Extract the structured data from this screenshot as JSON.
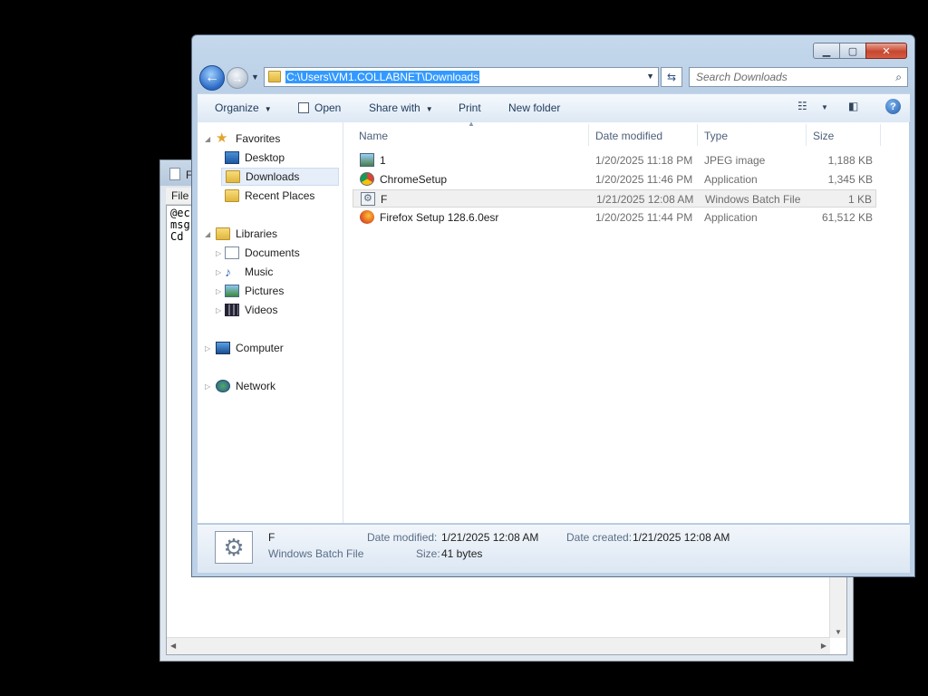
{
  "notepad": {
    "title_partial": "F",
    "menu_file": "File",
    "text": "@ec\nmsg\nCd"
  },
  "explorer": {
    "address": "C:\\Users\\VM1.COLLABNET\\Downloads",
    "search_placeholder": "Search Downloads",
    "toolbar": {
      "organize": "Organize",
      "open": "Open",
      "share_with": "Share with",
      "print": "Print",
      "new_folder": "New folder"
    },
    "nav": {
      "favorites": "Favorites",
      "desktop": "Desktop",
      "downloads": "Downloads",
      "recent_places": "Recent Places",
      "libraries": "Libraries",
      "documents": "Documents",
      "music": "Music",
      "pictures": "Pictures",
      "videos": "Videos",
      "computer": "Computer",
      "network": "Network"
    },
    "columns": {
      "name": "Name",
      "date_modified": "Date modified",
      "type": "Type",
      "size": "Size"
    },
    "files": [
      {
        "name": "1",
        "date": "1/20/2025 11:18 PM",
        "type": "JPEG image",
        "size": "1,188 KB",
        "icon": "jpeg-icon"
      },
      {
        "name": "ChromeSetup",
        "date": "1/20/2025 11:46 PM",
        "type": "Application",
        "size": "1,345 KB",
        "icon": "chrome-icon"
      },
      {
        "name": "F",
        "date": "1/21/2025 12:08 AM",
        "type": "Windows Batch File",
        "size": "1 KB",
        "icon": "batch-file-icon"
      },
      {
        "name": "Firefox Setup 128.6.0esr",
        "date": "1/20/2025 11:44 PM",
        "type": "Application",
        "size": "61,512 KB",
        "icon": "firefox-icon"
      }
    ],
    "details": {
      "name": "F",
      "type": "Windows Batch File",
      "date_modified_label": "Date modified:",
      "date_modified": "1/21/2025 12:08 AM",
      "date_created_label": "Date created:",
      "date_created": "1/21/2025 12:08 AM",
      "size_label": "Size:",
      "size": "41 bytes"
    }
  }
}
